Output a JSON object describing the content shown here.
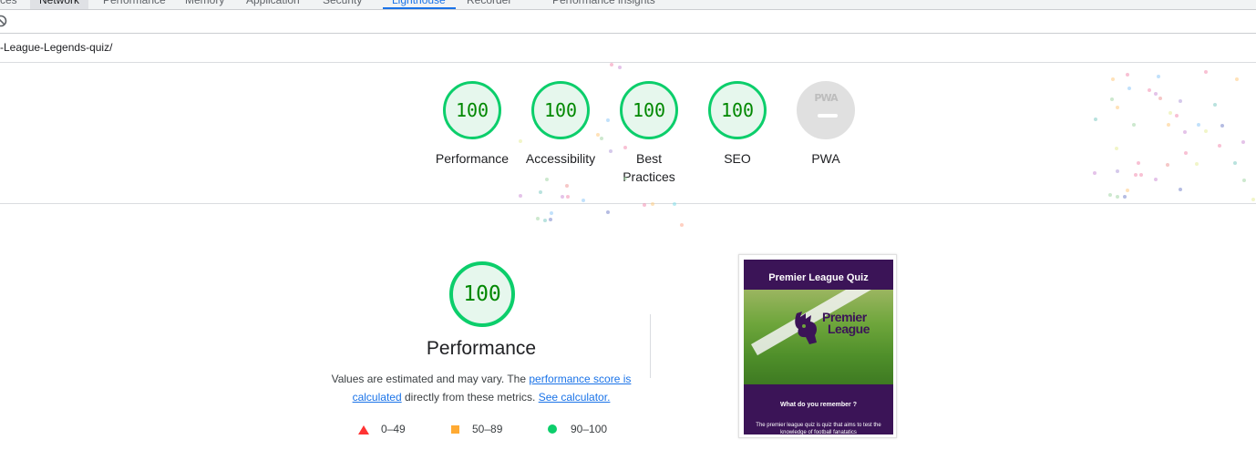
{
  "devtools": {
    "tabs": [
      "ces",
      "Network",
      "Performance",
      "Memory",
      "Application",
      "Security",
      "Lighthouse",
      "Recorder",
      "Performance insights"
    ],
    "selected_tab": "Lighthouse"
  },
  "url_bar": {
    "url": "-League-Legends-quiz/"
  },
  "scores": [
    {
      "label": "Performance",
      "value": "100"
    },
    {
      "label": "Accessibility",
      "value": "100"
    },
    {
      "label": "Best Practices",
      "value": "100"
    },
    {
      "label": "SEO",
      "value": "100"
    },
    {
      "label": "PWA",
      "value": "PWA"
    }
  ],
  "performance": {
    "score": "100",
    "title": "Performance",
    "desc_before": "Values are estimated and may vary. The ",
    "link_score": "performance score is calculated",
    "desc_middle": " directly from these metrics. ",
    "link_calc": "See calculator."
  },
  "legend": [
    {
      "range": "0–49",
      "color": "#ff3333",
      "shape": "triangle"
    },
    {
      "range": "50–89",
      "color": "#ffaa33",
      "shape": "square"
    },
    {
      "range": "90–100",
      "color": "#0cce6b",
      "shape": "circle"
    }
  ],
  "screenshot": {
    "title": "Premier League Quiz",
    "logo_line1": "Premier",
    "logo_line2": "League",
    "question": "What do you remember ?",
    "blurb": "The premier league quiz is quiz that aims to test the knowledge of football fanatatics"
  },
  "colors": {
    "pass": "#0cce6b",
    "pass_text": "#008800",
    "link": "#1a73e8",
    "thumb_bg": "#3b1457"
  }
}
